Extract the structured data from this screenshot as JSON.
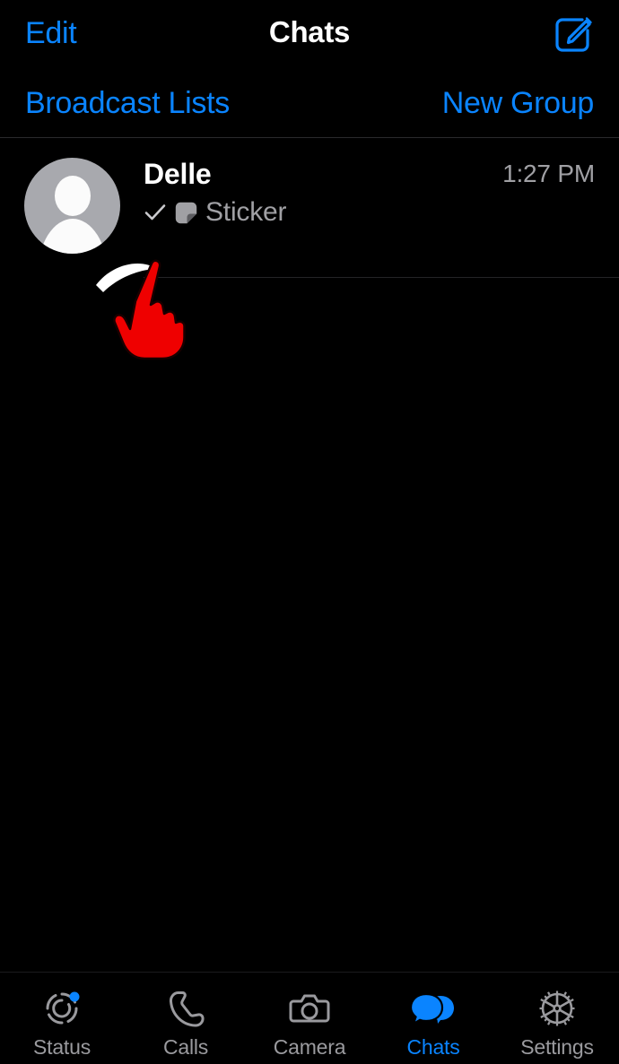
{
  "navbar": {
    "edit_label": "Edit",
    "title": "Chats",
    "compose_icon": "compose-pencil-square-icon"
  },
  "subrow": {
    "broadcast_label": "Broadcast Lists",
    "new_group_label": "New Group"
  },
  "chats": [
    {
      "name": "Delle",
      "status_icon": "single-check-icon",
      "attachment_icon": "sticker-icon",
      "preview": "Sticker",
      "time": "1:27 PM",
      "avatar_icon": "default-person-avatar-icon"
    }
  ],
  "annotation": {
    "cursor_icon": "red-pointing-hand-cursor-icon",
    "gesture_icon": "white-swipe-arc-icon"
  },
  "tabbar": {
    "items": [
      {
        "label": "Status",
        "icon": "status-rings-icon",
        "active": false,
        "badge": true
      },
      {
        "label": "Calls",
        "icon": "phone-handset-icon",
        "active": false,
        "badge": false
      },
      {
        "label": "Camera",
        "icon": "camera-icon",
        "active": false,
        "badge": false
      },
      {
        "label": "Chats",
        "icon": "chat-bubbles-icon",
        "active": true,
        "badge": false
      },
      {
        "label": "Settings",
        "icon": "gear-icon",
        "active": false,
        "badge": false
      }
    ]
  },
  "colors": {
    "accent_blue": "#0a84ff",
    "background": "#000000",
    "primary_text": "#ffffff",
    "secondary_text": "#a0a0a4",
    "avatar_grey": "#a8a9ae",
    "cursor_red": "#ef0000"
  }
}
